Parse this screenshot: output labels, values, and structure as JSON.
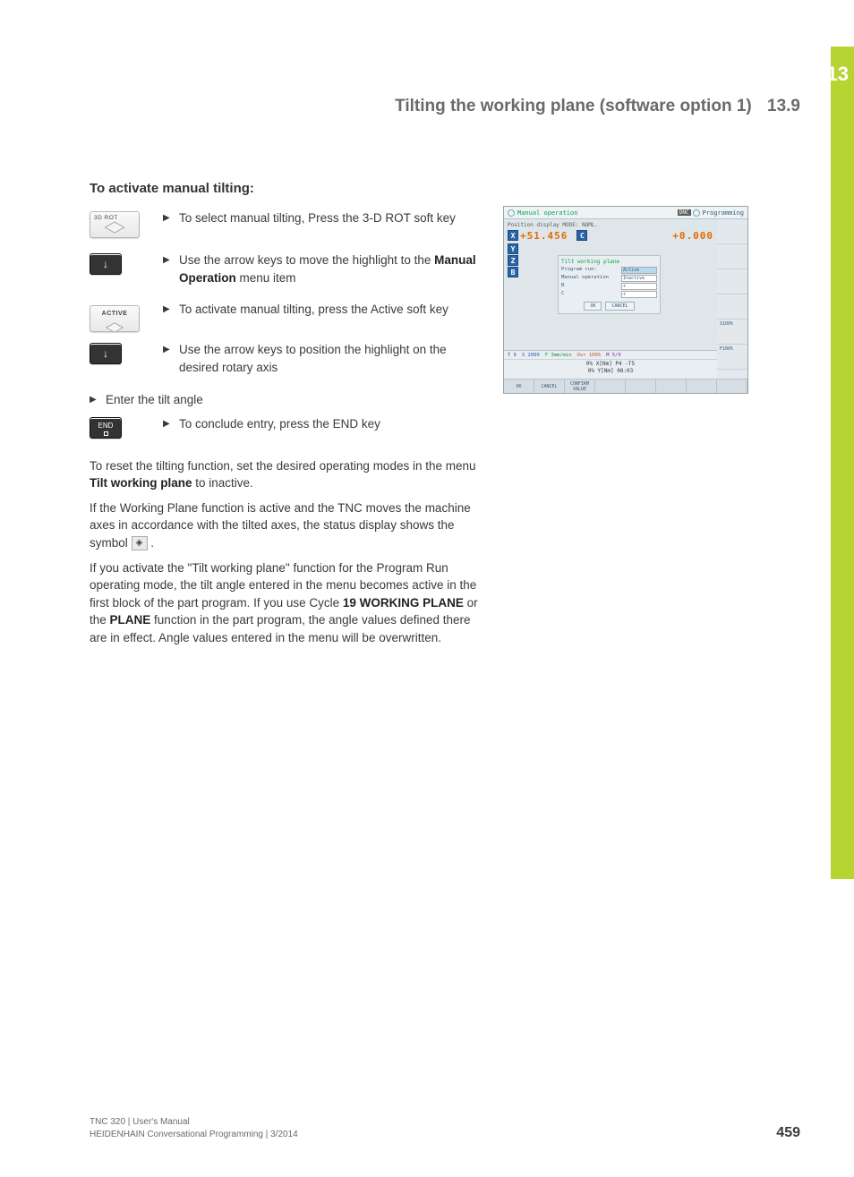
{
  "chapter": "13",
  "header": {
    "title": "Tilting the working plane (software option 1)",
    "section": "13.9"
  },
  "heading": "To activate manual tilting:",
  "keys": {
    "rot3d": "3D ROT",
    "active": "ACTIVE",
    "end": "END"
  },
  "steps": [
    {
      "text": "To select manual tilting, Press the 3-D ROT soft key"
    },
    {
      "pre": "Use the arrow keys to move the highlight to the ",
      "bold": "Manual Operation",
      "post": " menu item"
    },
    {
      "text": "To activate manual tilting, press the Active soft key"
    },
    {
      "text": "Use the arrow keys to position the highlight on the desired rotary axis"
    }
  ],
  "enter_line": "Enter the tilt angle",
  "conclude_line": "To conclude entry, press the END key",
  "paras": {
    "p1_pre": "To reset the tilting function, set the desired operating modes in the menu ",
    "p1_bold": "Tilt working plane",
    "p1_post": " to inactive.",
    "p2_pre": "If the Working Plane function is active and the TNC moves the machine axes in accordance with the tilted axes, the status display shows the symbol ",
    "p2_post": " .",
    "p3_pre": "If you activate the \"Tilt working plane\" function for the Program Run operating mode, the tilt angle entered in the menu becomes active in the first block of the part program. If you use Cycle ",
    "p3_b1": "19 WORKING PLANE",
    "p3_mid": " or the ",
    "p3_b2": "PLANE",
    "p3_post": " function in the part program, the angle values defined there are in effect. Angle values entered in the menu will be overwritten."
  },
  "screenshot": {
    "mode1": "Manual operation",
    "dnc": "DNC",
    "mode2": "Programming",
    "posline": "Position display MODE: NOML.",
    "axes": [
      "X",
      "Y",
      "Z",
      "B"
    ],
    "x_val": "+51.456",
    "c_label": "C",
    "c_val": "+0.000",
    "dialog": {
      "title": "Tilt working plane",
      "row1_label": "Program run:",
      "row1_val": "Active",
      "row2_label": "Manual operation",
      "row2_val": "Inactive",
      "rowB": "B",
      "rowC": "C",
      "rowB_val": "+",
      "rowC_val": "+",
      "ok": "OK",
      "cancel": "CANCEL"
    },
    "status": {
      "bar_items": [
        "T 6",
        "S 2000",
        "F 3mm/min",
        "Ovr 100%",
        "M 5/9"
      ],
      "line1": "0% X[Nm]  P4  -T5",
      "line2": "0% Y[Nm]  08:03"
    },
    "sidebar_labels": [
      "S100%",
      "F100%"
    ],
    "softkeys": [
      "OK",
      "CANCEL",
      "CONFIRM VALUE",
      "",
      "",
      "",
      "",
      ""
    ]
  },
  "footer": {
    "line1": "TNC 320 | User's Manual",
    "line2": "HEIDENHAIN Conversational Programming | 3/2014"
  },
  "page_number": "459"
}
